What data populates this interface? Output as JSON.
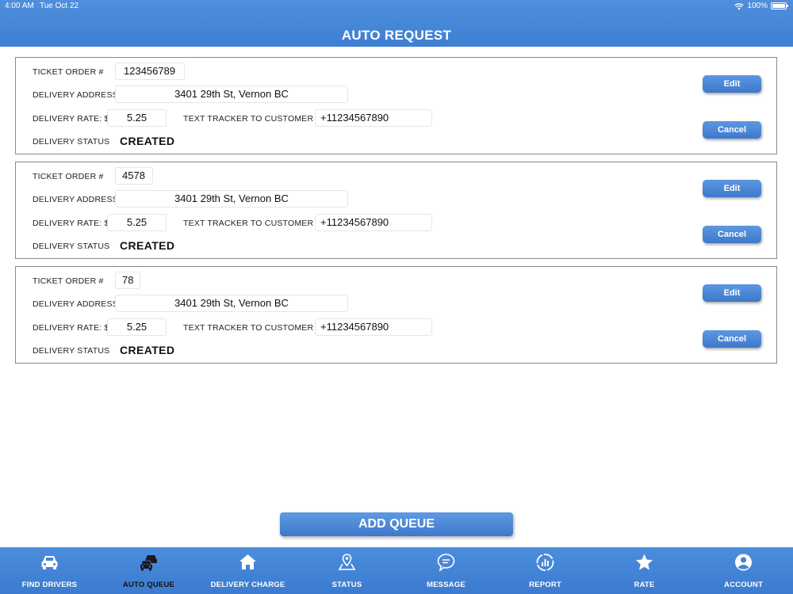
{
  "status_bar": {
    "time": "4:00 AM",
    "date": "Tue Oct 22",
    "battery": "100%"
  },
  "header": {
    "title": "AUTO REQUEST"
  },
  "labels": {
    "ticket": "TICKET ORDER #",
    "address": "DELIVERY ADDRESS",
    "rate": "DELIVERY RATE: $",
    "tracker": "TEXT TRACKER TO CUSTOMER #",
    "status": "DELIVERY STATUS",
    "edit": "Edit",
    "cancel": "Cancel"
  },
  "orders": [
    {
      "ticket": "123456789",
      "address": "3401 29th St, Vernon BC",
      "rate": "5.25",
      "tracker": "+11234567890",
      "status": "CREATED"
    },
    {
      "ticket": "4578",
      "address": "3401 29th St, Vernon BC",
      "rate": "5.25",
      "tracker": "+11234567890",
      "status": "CREATED"
    },
    {
      "ticket": "78",
      "address": "3401 29th St, Vernon BC",
      "rate": "5.25",
      "tracker": "+11234567890",
      "status": "CREATED"
    }
  ],
  "add_queue_label": "ADD QUEUE",
  "tabs": [
    {
      "label": "FIND DRIVERS",
      "icon": "car-icon",
      "active": false
    },
    {
      "label": "AUTO QUEUE",
      "icon": "cars-queue-icon",
      "active": true
    },
    {
      "label": "DELIVERY CHARGE",
      "icon": "home-icon",
      "active": false
    },
    {
      "label": "STATUS",
      "icon": "map-pin-icon",
      "active": false
    },
    {
      "label": "MESSAGE",
      "icon": "chat-bubble-icon",
      "active": false
    },
    {
      "label": "REPORT",
      "icon": "report-chart-icon",
      "active": false
    },
    {
      "label": "RATE",
      "icon": "star-icon",
      "active": false
    },
    {
      "label": "ACCOUNT",
      "icon": "account-icon",
      "active": false
    }
  ],
  "colors": {
    "accent": "#3f7fd2",
    "active_tab_text": "#111111"
  }
}
